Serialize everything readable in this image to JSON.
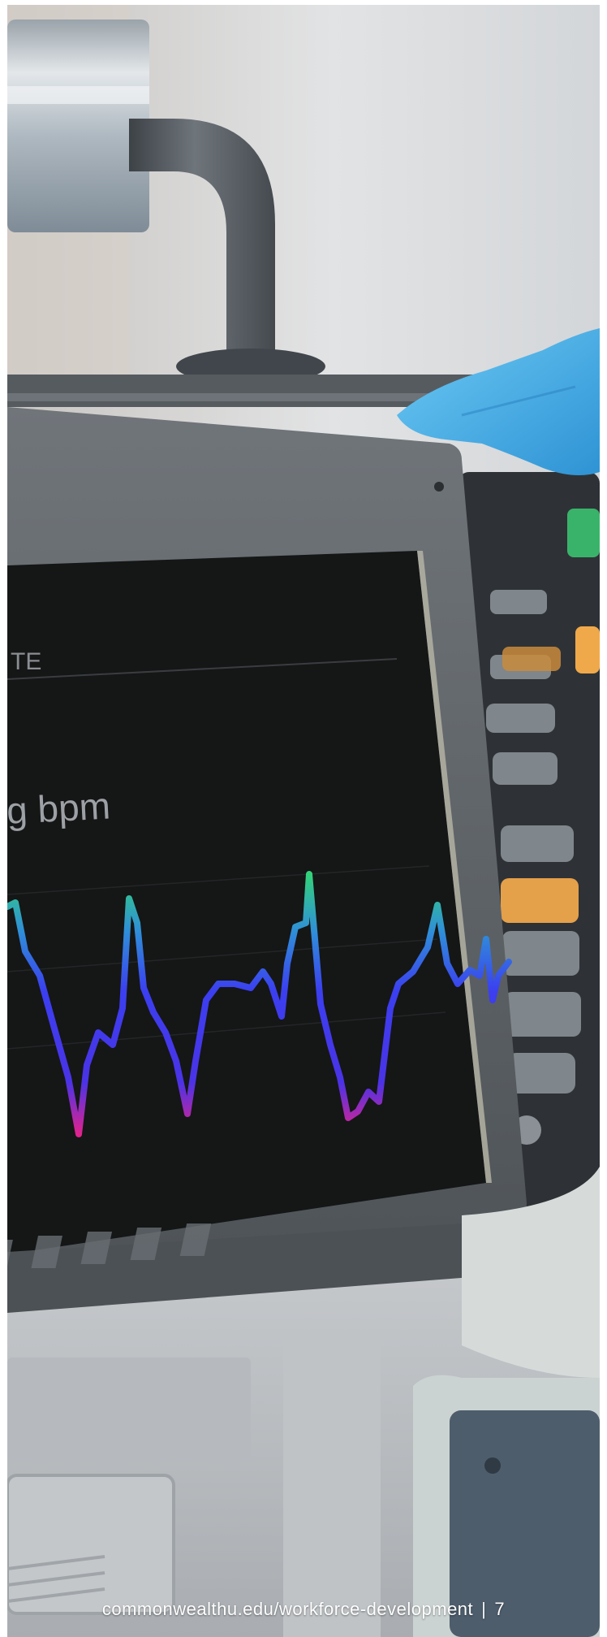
{
  "photo": {
    "subject": "medical-monitor-with-gloved-hand",
    "screen": {
      "label_fragment": "TE",
      "reading_fragment": "g bpm"
    },
    "colors": {
      "trace_green": "#33d27a",
      "trace_blue": "#3b3ff0",
      "trace_magenta": "#e0238e",
      "glove": "#4ab4ea",
      "accent_green_button": "#3ab36a",
      "accent_orange_button": "#f0a94a",
      "screen_bg": "#151616",
      "bezel": "#5e6367"
    }
  },
  "footer": {
    "url": "commonwealthu.edu/workforce-development",
    "separator": "|",
    "page_number": "7"
  }
}
